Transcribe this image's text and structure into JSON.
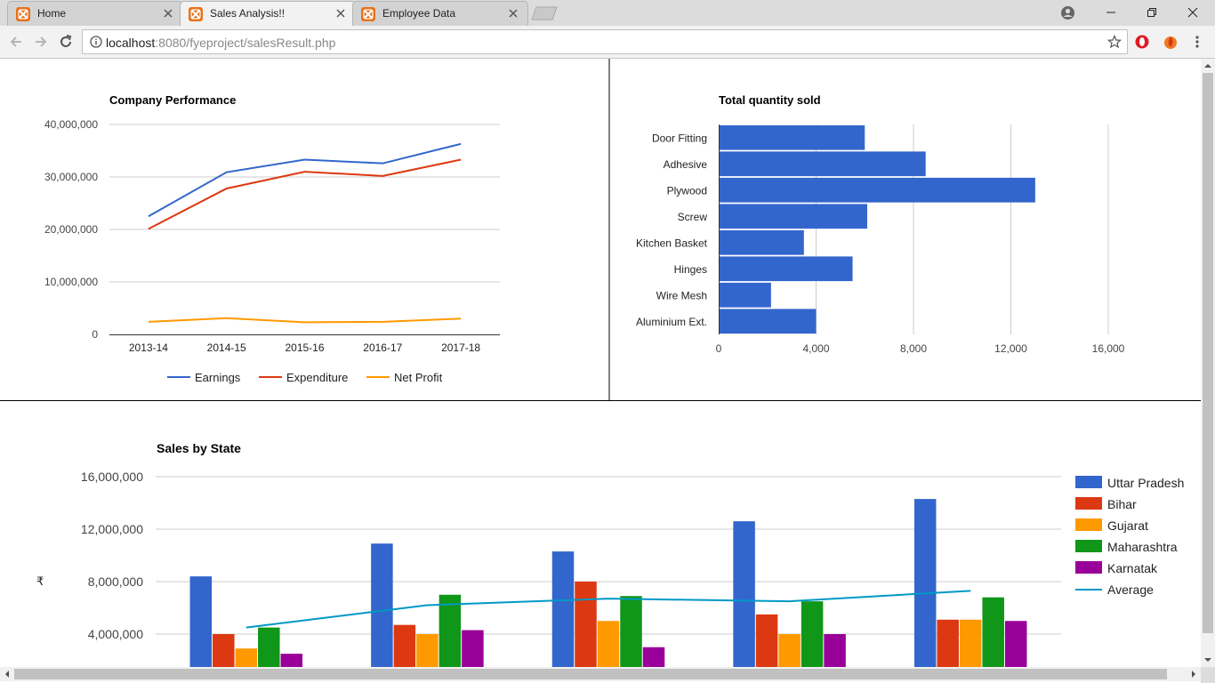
{
  "browser": {
    "tabs": [
      {
        "title": "Home",
        "active": false
      },
      {
        "title": "Sales Analysis!!",
        "active": true
      },
      {
        "title": "Employee Data",
        "active": false
      }
    ],
    "url_host": "localhost",
    "url_rest": ":8080/fyeproject/salesResult.php",
    "accent": "#e8711a"
  },
  "charts": {
    "performance": {
      "title": "Company Performance",
      "legend": [
        "Earnings",
        "Expenditure",
        "Net Profit"
      ]
    },
    "quantity": {
      "title": "Total quantity sold"
    },
    "state": {
      "title": "Sales by State",
      "ylabel": "₹",
      "legend": [
        "Uttar Pradesh",
        "Bihar",
        "Gujarat",
        "Maharashtra",
        "Karnatak",
        "Average"
      ]
    }
  },
  "chart_data": [
    {
      "type": "line",
      "title": "Company Performance",
      "categories": [
        "2013-14",
        "2014-15",
        "2015-16",
        "2016-17",
        "2017-18"
      ],
      "series": [
        {
          "name": "Earnings",
          "color": "#3366cc",
          "values": [
            22500000,
            30900000,
            33300000,
            32600000,
            36300000
          ]
        },
        {
          "name": "Expenditure",
          "color": "#dc3912",
          "values": [
            20100000,
            27800000,
            31000000,
            30200000,
            33300000
          ]
        },
        {
          "name": "Net Profit",
          "color": "#ff9900",
          "values": [
            2400000,
            3100000,
            2300000,
            2400000,
            3000000
          ]
        }
      ],
      "ylim": [
        0,
        40000000
      ],
      "yticks": [
        0,
        10000000,
        20000000,
        30000000,
        40000000
      ],
      "ytick_labels": [
        "0",
        "10,000,000",
        "20,000,000",
        "30,000,000",
        "40,000,000"
      ],
      "legend": "bottom"
    },
    {
      "type": "bar",
      "orientation": "horizontal",
      "title": "Total quantity sold",
      "categories": [
        "Door Fitting",
        "Adhesive",
        "Plywood",
        "Screw",
        "Kitchen Basket",
        "Hinges",
        "Wire Mesh",
        "Aluminium Ext."
      ],
      "values": [
        6000,
        8500,
        13000,
        6100,
        3500,
        5500,
        2150,
        4000
      ],
      "color": "#3366cc",
      "xlim": [
        0,
        16000
      ],
      "xticks": [
        0,
        4000,
        8000,
        12000,
        16000
      ],
      "xtick_labels": [
        "0",
        "4,000",
        "8,000",
        "12,000",
        "16,000"
      ]
    },
    {
      "type": "bar",
      "title": "Sales by State",
      "ylabel": "₹",
      "groups": 5,
      "series": [
        {
          "name": "Uttar Pradesh",
          "color": "#3366cc",
          "values": [
            8400000,
            10900000,
            10300000,
            12600000,
            14300000
          ]
        },
        {
          "name": "Bihar",
          "color": "#dc3912",
          "values": [
            4000000,
            4700000,
            8000000,
            5500000,
            5100000
          ]
        },
        {
          "name": "Gujarat",
          "color": "#ff9900",
          "values": [
            2900000,
            4000000,
            5000000,
            4000000,
            5100000
          ]
        },
        {
          "name": "Maharashtra",
          "color": "#109618",
          "values": [
            4500000,
            7000000,
            6900000,
            6500000,
            6800000
          ]
        },
        {
          "name": "Karnatak",
          "color": "#990099",
          "values": [
            2500000,
            4300000,
            3000000,
            4000000,
            5000000
          ]
        }
      ],
      "average": {
        "name": "Average",
        "color": "#0099c6",
        "values": [
          4500000,
          6200000,
          6700000,
          6500000,
          7300000
        ]
      },
      "ylim": [
        0,
        16000000
      ],
      "yticks": [
        4000000,
        8000000,
        12000000,
        16000000
      ],
      "ytick_labels": [
        "4,000,000",
        "8,000,000",
        "12,000,000",
        "16,000,000"
      ],
      "legend": "right"
    }
  ]
}
